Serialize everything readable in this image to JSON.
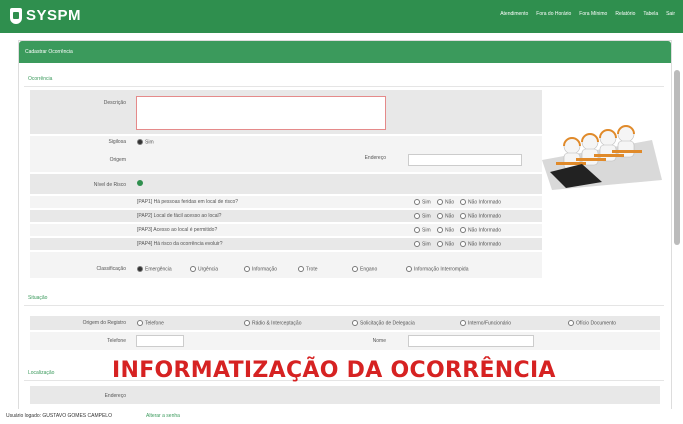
{
  "app": {
    "logo_text": "SYSPM"
  },
  "nav": [
    "Atendimento",
    "Fora do Horário",
    "Fora Mínimo",
    "Relatório",
    "Tabela",
    "Sair"
  ],
  "page_title": "Cadastrar Ocorrência",
  "sections": {
    "ocorrencia": "Ocorrência",
    "situacao": "Situação",
    "localizacao": "Localização"
  },
  "form": {
    "descricao_label": "Descrição",
    "sigilosa_label": "Sigilosa",
    "sigilosa_value": "Sim",
    "origem_label": "Origem",
    "endereco_label": "Endereço",
    "nivel_label": "Nível de Risco",
    "questions": [
      "[PAP1] Há pessoas feridas em local de risco?",
      "[PAP2] Local de fácil acesso ao local?",
      "[PAP3] Acesso ao local é permitido?",
      "[PAP4] Há risco da ocorrência evoluir?"
    ],
    "answer_opts": [
      "Sim",
      "Não",
      "Não Informado"
    ],
    "classificacao_label": "Classificação",
    "classificacao_opts": [
      "Emergência",
      "Urgência",
      "Informação",
      "Trote",
      "Engano",
      "Informação Interrompida"
    ],
    "origem_registro_label": "Origem do Registro",
    "origem_registro_opts": [
      "Telefone",
      "Rádio & Interceptação",
      "Solicitação de Delegacia",
      "Interno/Funcionário",
      "Ofício Documento"
    ],
    "telefone_label": "Telefone",
    "nome_label": "Nome",
    "endereco2_label": "Endereço"
  },
  "overlay_text": "INFORMATIZAÇÃO DA OCORRÊNCIA",
  "footer": {
    "user": "Usuário logado: GUSTAVO GOMES CAMPELO",
    "link": "Alterar a senha"
  }
}
